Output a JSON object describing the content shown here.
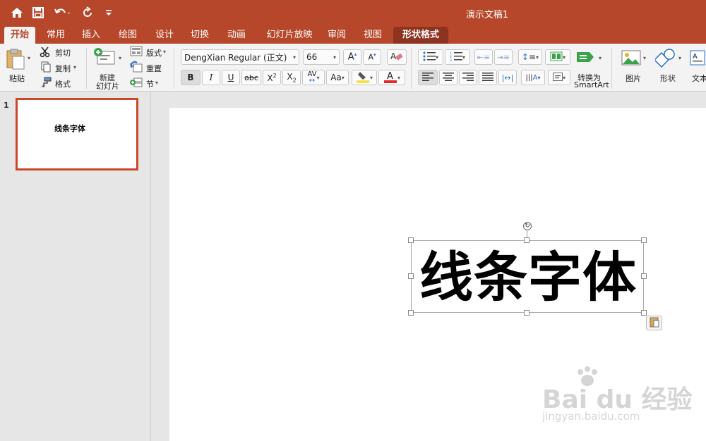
{
  "window": {
    "title": "演示文稿1"
  },
  "tabs": [
    {
      "label": "开始"
    },
    {
      "label": "常用"
    },
    {
      "label": "插入"
    },
    {
      "label": "绘图"
    },
    {
      "label": "设计"
    },
    {
      "label": "切换"
    },
    {
      "label": "动画"
    },
    {
      "label": "幻灯片放映"
    },
    {
      "label": "审阅"
    },
    {
      "label": "视图"
    },
    {
      "label": "形状格式"
    }
  ],
  "ribbon": {
    "paste": "粘贴",
    "cut": "剪切",
    "copy": "复制",
    "format": "格式",
    "new_slide": "新建",
    "new_slide_2": "幻灯片",
    "layout": "版式",
    "reset": "重置",
    "section": "节",
    "font_name": "DengXian Regular (正文)",
    "font_size": "66",
    "bold": "B",
    "italic": "I",
    "underline": "U",
    "strike": "abc",
    "convert": "转换为",
    "smartart": "SmartArt",
    "picture": "图片",
    "shape": "形状",
    "textbox": "文本"
  },
  "slides": [
    {
      "number": "1",
      "thumb_text": "线条字体"
    }
  ],
  "slide_content": {
    "text": "线条字体"
  },
  "watermark": {
    "main": "Bai du 经验",
    "sub": "jingyan.baidu.com"
  },
  "colors": {
    "accent": "#b7472a",
    "shape_tab": "#8e3320",
    "thumb_border": "#c9472a"
  }
}
